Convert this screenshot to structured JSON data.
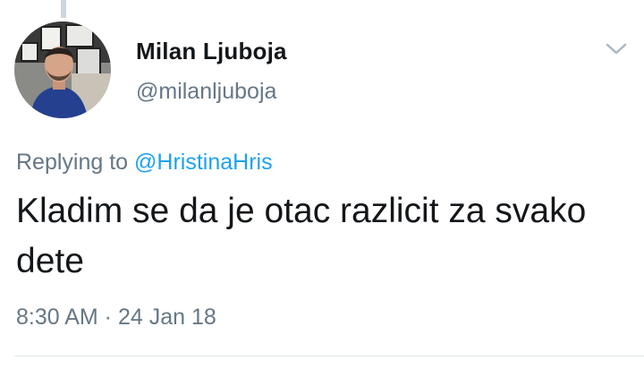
{
  "tweet": {
    "author": {
      "display_name": "Milan Ljuboja",
      "handle": "@milanljuboja"
    },
    "reply_context": {
      "prefix": "Replying to",
      "mention": "@HristinaHris"
    },
    "text": "Kladim se da je otac razlicit za svako dete",
    "timestamp": "8:30 AM · 24 Jan 18"
  },
  "icons": {
    "menu": "chevron-down-icon"
  },
  "colors": {
    "link": "#1da1f2",
    "secondary_text": "#657786",
    "primary_text": "#14171a"
  }
}
